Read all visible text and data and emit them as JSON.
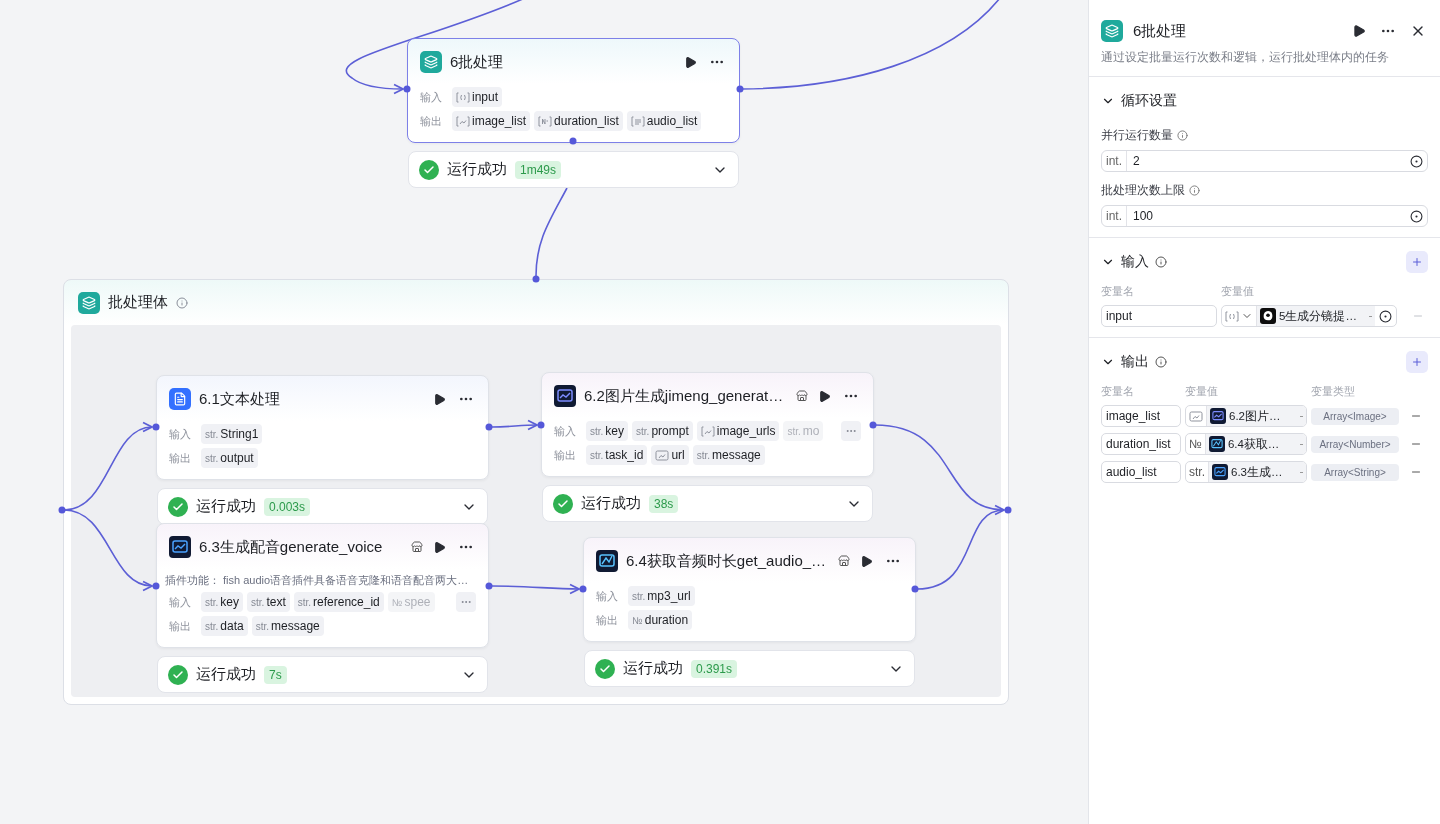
{
  "canvas": {
    "batch_node": {
      "title": "6批处理",
      "selected": true,
      "plugin": false,
      "input_label": "输入",
      "output_label": "输出",
      "inputs": [
        {
          "kind": "array",
          "name": "input",
          "faded": false
        }
      ],
      "outputs": [
        {
          "kind": "array_image",
          "name": "image_list",
          "faded": false
        },
        {
          "kind": "array_number",
          "name": "duration_list",
          "faded": false
        },
        {
          "kind": "array_string",
          "name": "audio_list",
          "faded": false
        }
      ],
      "more_ports": false,
      "status": {
        "succeeded": true,
        "label": "运行成功",
        "time": "1m49s"
      }
    },
    "batch_body": {
      "title": "批处理体",
      "nodes": [
        {
          "title": "6.1文本处理",
          "selected": false,
          "plugin": false,
          "input_label": "输入",
          "output_label": "输出",
          "inputs": [
            {
              "kind": "tagged",
              "tag": "str.",
              "name": "String1",
              "faded": false
            }
          ],
          "outputs": [
            {
              "kind": "tagged",
              "tag": "str.",
              "name": "output",
              "faded": false
            }
          ],
          "more_ports": false,
          "status": {
            "succeeded": true,
            "label": "运行成功",
            "time": "0.003s"
          }
        },
        {
          "title": "6.2图片生成jimeng_generat…",
          "selected": false,
          "plugin": true,
          "input_label": "输入",
          "output_label": "输出",
          "inputs": [
            {
              "kind": "tagged",
              "tag": "str.",
              "name": "key",
              "faded": false
            },
            {
              "kind": "tagged",
              "tag": "str.",
              "name": "prompt",
              "faded": false
            },
            {
              "kind": "array_image",
              "name": "image_urls",
              "faded": false
            },
            {
              "kind": "tagged",
              "tag": "str.",
              "name": "mo",
              "faded": true
            }
          ],
          "outputs": [
            {
              "kind": "tagged",
              "tag": "str.",
              "name": "task_id",
              "faded": false
            },
            {
              "kind": "image",
              "name": "url",
              "faded": false
            },
            {
              "kind": "tagged",
              "tag": "str.",
              "name": "message",
              "faded": false
            }
          ],
          "more_ports": true,
          "status": {
            "succeeded": true,
            "label": "运行成功",
            "time": "38s"
          }
        },
        {
          "title": "6.3生成配音generate_voice",
          "selected": false,
          "plugin": true,
          "description": "插件功能： fish audio语音插件具备语音克隆和语音配音两大…",
          "input_label": "输入",
          "output_label": "输出",
          "inputs": [
            {
              "kind": "tagged",
              "tag": "str.",
              "name": "key",
              "faded": false
            },
            {
              "kind": "tagged",
              "tag": "str.",
              "name": "text",
              "faded": false
            },
            {
              "kind": "tagged",
              "tag": "str.",
              "name": "reference_id",
              "faded": false
            },
            {
              "kind": "tagged",
              "tag": "№",
              "name": "spee",
              "faded": true
            }
          ],
          "outputs": [
            {
              "kind": "tagged",
              "tag": "str.",
              "name": "data",
              "faded": false
            },
            {
              "kind": "tagged",
              "tag": "str.",
              "name": "message",
              "faded": false
            }
          ],
          "more_ports": true,
          "status": {
            "succeeded": true,
            "label": "运行成功",
            "time": "7s"
          }
        },
        {
          "title": "6.4获取音频时长get_audio_…",
          "selected": false,
          "plugin": true,
          "input_label": "输入",
          "output_label": "输出",
          "inputs": [
            {
              "kind": "tagged",
              "tag": "str.",
              "name": "mp3_url",
              "faded": false
            }
          ],
          "outputs": [
            {
              "kind": "tagged",
              "tag": "№",
              "name": "duration",
              "faded": false
            }
          ],
          "more_ports": false,
          "status": {
            "succeeded": true,
            "label": "运行成功",
            "time": "0.391s"
          }
        }
      ]
    }
  },
  "panel": {
    "title": "6批处理",
    "description": "通过设定批量运行次数和逻辑，运行批处理体内的任务",
    "loop": {
      "title": "循环设置",
      "expanded": true,
      "fields": [
        {
          "label": "并行运行数量",
          "type_tag": "int.",
          "value": "2"
        },
        {
          "label": "批处理次数上限",
          "type_tag": "int.",
          "value": "100"
        }
      ]
    },
    "inputs": {
      "title": "输入",
      "expanded": true,
      "columns": [
        "变量名",
        "变量值"
      ],
      "rows": [
        {
          "name": "input",
          "kind": "array",
          "source": "5生成分镜提…"
        }
      ]
    },
    "outputs": {
      "title": "输出",
      "expanded": true,
      "columns": [
        "变量名",
        "变量值",
        "变量类型"
      ],
      "rows": [
        {
          "name": "image_list",
          "kind": "image",
          "source": "6.2图片…",
          "var_type": "Array<Image>"
        },
        {
          "name": "duration_list",
          "kind": "tagged",
          "tag": "№",
          "source": "6.4获取…",
          "var_type": "Array<Number>"
        },
        {
          "name": "audio_list",
          "kind": "tagged",
          "tag": "str.",
          "source": "6.3生成…",
          "var_type": "Array<String>"
        }
      ]
    }
  }
}
